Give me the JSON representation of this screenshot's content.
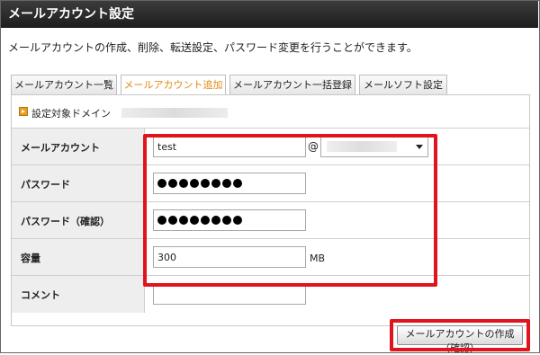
{
  "window": {
    "title": "メールアカウント設定",
    "description": "メールアカウントの作成、削除、転送設定、パスワード変更を行うことができます。"
  },
  "tabs": [
    {
      "label": "メールアカウント一覧",
      "active": false
    },
    {
      "label": "メールアカウント追加",
      "active": true
    },
    {
      "label": "メールアカウント一括登録",
      "active": false
    },
    {
      "label": "メールソフト設定",
      "active": false
    }
  ],
  "domain": {
    "label": "設定対象ドメイン"
  },
  "form": {
    "account": {
      "label": "メールアカウント",
      "value": "test",
      "at": "@"
    },
    "password": {
      "label": "パスワード",
      "masked_length": 8
    },
    "password_confirm": {
      "label": "パスワード（確認）",
      "masked_length": 8
    },
    "capacity": {
      "label": "容量",
      "value": "300",
      "unit": "MB"
    },
    "comment": {
      "label": "コメント",
      "value": ""
    }
  },
  "submit": {
    "label": "メールアカウントの作成（確認）"
  },
  "colors": {
    "highlight": "#e0141c",
    "active_tab_text": "#e08a14",
    "title_bar": "#2a2a2a"
  },
  "icons": {
    "domain_marker": "orange-square-arrow-icon",
    "select_arrow": "chevron-down-icon"
  }
}
